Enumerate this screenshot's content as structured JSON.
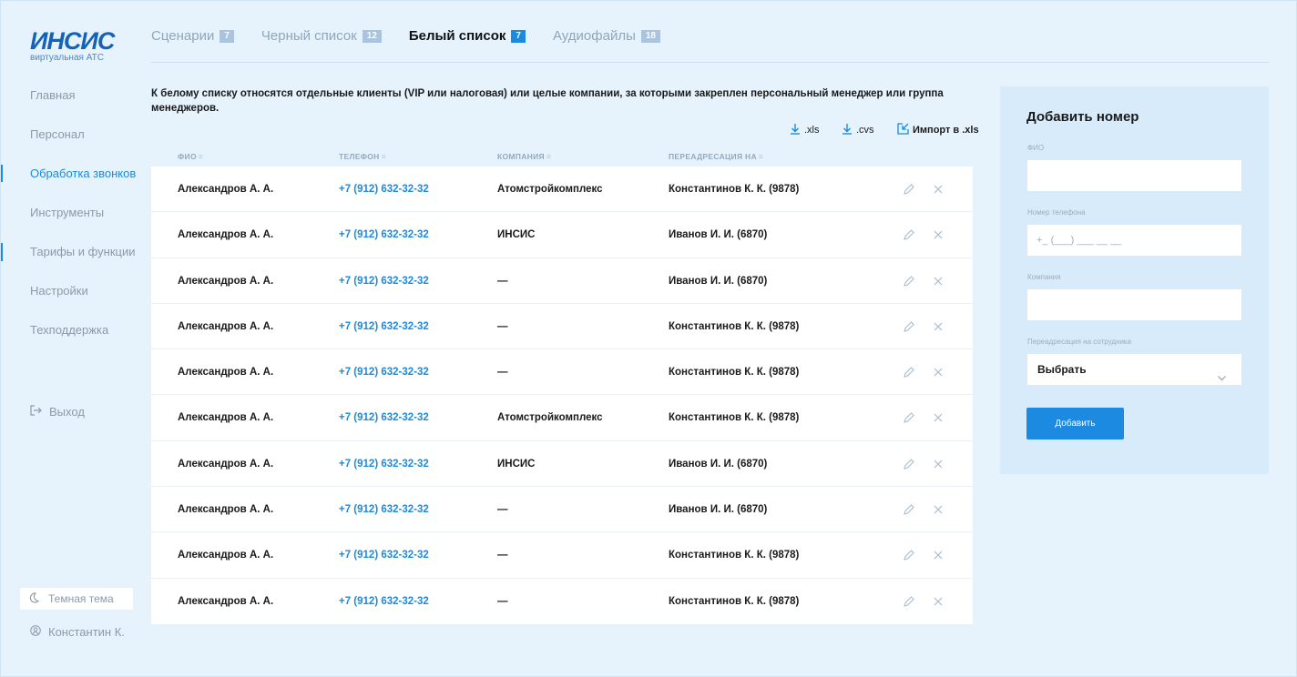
{
  "logo": {
    "mark": "ИНСИС",
    "subtitle": "виртуальная АТС"
  },
  "sidebar": {
    "items": [
      {
        "label": "Главная"
      },
      {
        "label": "Персонал"
      },
      {
        "label": "Обработка звонков",
        "active": true
      },
      {
        "label": "Инструменты"
      },
      {
        "label": "Тарифы и функции"
      },
      {
        "label": "Настройки"
      },
      {
        "label": "Техподдержка"
      }
    ],
    "logout_label": "Выход",
    "theme_label": "Темная тема",
    "user_label": "Константин К."
  },
  "tabs": [
    {
      "label": "Сценарии",
      "count": "7"
    },
    {
      "label": "Черный список",
      "count": "12"
    },
    {
      "label": "Белый список",
      "count": "7",
      "active": true
    },
    {
      "label": "Аудиофайлы",
      "count": "18"
    }
  ],
  "description": "К белому списку относятся отдельные клиенты (VIP или налоговая) или целые компании, за которыми закреплен персональный менеджер или группа менеджеров.",
  "downloads": {
    "xls": ".xls",
    "cvs": ".cvs",
    "import": "Импорт в .xls"
  },
  "table": {
    "columns": [
      "ФИО",
      "ТЕЛЕФОН",
      "КОМПАНИЯ",
      "ПЕРЕАДРЕСАЦИЯ НА"
    ],
    "rows": [
      [
        "Александров А. А.",
        "+7 (912) 632-32-32",
        "Атомстройкомплекс",
        "Константинов К. К. (9878)"
      ],
      [
        "Александров А. А.",
        "+7 (912) 632-32-32",
        "ИНСИС",
        "Иванов И. И. (6870)"
      ],
      [
        "Александров А. А.",
        "+7 (912) 632-32-32",
        "—",
        "Иванов И. И. (6870)"
      ],
      [
        "Александров А. А.",
        "+7 (912) 632-32-32",
        "—",
        "Константинов К. К. (9878)"
      ],
      [
        "Александров А. А.",
        "+7 (912) 632-32-32",
        "—",
        "Константинов К. К. (9878)"
      ],
      [
        "Александров А. А.",
        "+7 (912) 632-32-32",
        "Атомстройкомплекс",
        "Константинов К. К. (9878)"
      ],
      [
        "Александров А. А.",
        "+7 (912) 632-32-32",
        "ИНСИС",
        "Иванов И. И. (6870)"
      ],
      [
        "Александров А. А.",
        "+7 (912) 632-32-32",
        "—",
        "Иванов И. И. (6870)"
      ],
      [
        "Александров А. А.",
        "+7 (912) 632-32-32",
        "—",
        "Константинов К. К. (9878)"
      ],
      [
        "Александров А. А.",
        "+7 (912) 632-32-32",
        "—",
        "Константинов К. К. (9878)"
      ]
    ]
  },
  "form": {
    "title": "Добавить номер",
    "fio_label": "ФИО",
    "fio_value": "",
    "phone_label": "Номер телефона",
    "phone_placeholder": "+_ (___) ___ __ __",
    "company_label": "Компания",
    "company_value": "",
    "redirect_label": "Переадресация на сотрудника",
    "redirect_value": "Выбрать",
    "submit_label": "Добавить"
  },
  "colors": {
    "accent": "#1b8ae0",
    "background": "#e6f3fd",
    "panel": "#d7ebfb",
    "muted": "#8c9aa8"
  }
}
